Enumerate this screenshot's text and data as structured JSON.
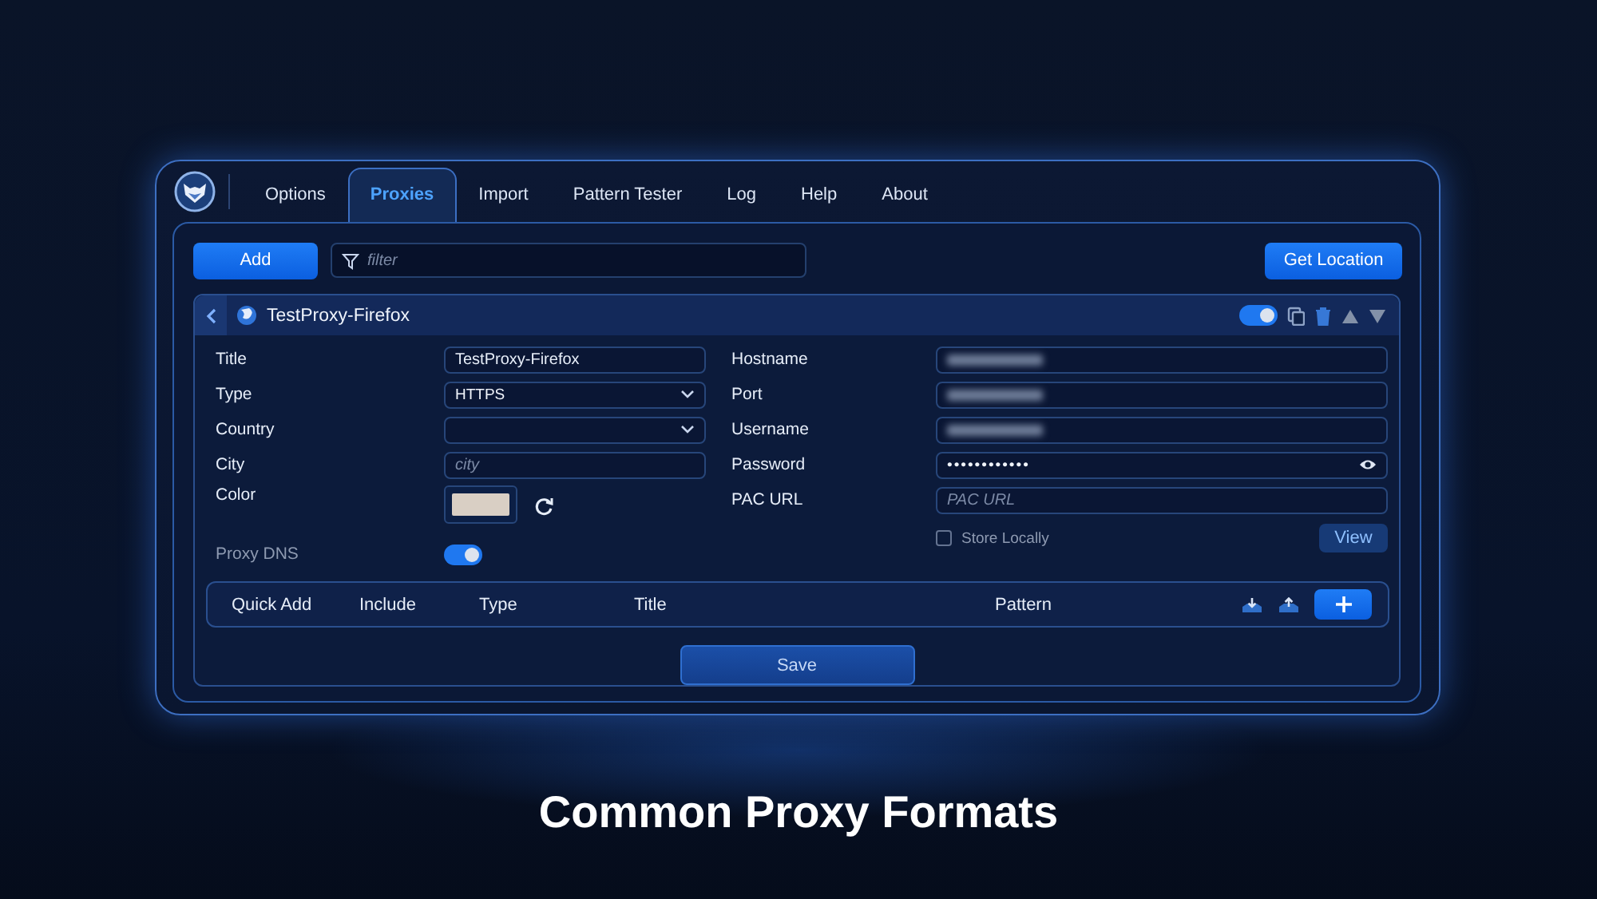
{
  "tabs": [
    {
      "label": "Options",
      "selected": false
    },
    {
      "label": "Proxies",
      "selected": true
    },
    {
      "label": "Import",
      "selected": false
    },
    {
      "label": "Pattern Tester",
      "selected": false
    },
    {
      "label": "Log",
      "selected": false
    },
    {
      "label": "Help",
      "selected": false
    },
    {
      "label": "About",
      "selected": false
    }
  ],
  "toolbar": {
    "add_button": "Add",
    "filter": {
      "placeholder": "filter"
    },
    "location_button": "Get Location"
  },
  "proxy": {
    "title": "TestProxy-Firefox",
    "enabled": true,
    "left_fields": [
      {
        "label": "Title",
        "kind": "text",
        "value": "TestProxy-Firefox"
      },
      {
        "label": "Type",
        "kind": "select",
        "value": "HTTPS"
      },
      {
        "label": "Country",
        "kind": "select"
      },
      {
        "label": "City",
        "kind": "text",
        "placeholder": "city"
      },
      {
        "label": "Color",
        "kind": "color",
        "color": "#d9cfc4"
      }
    ],
    "proxy_dns": {
      "label": "Proxy DNS",
      "on": true
    },
    "right_fields": [
      {
        "label": "Hostname",
        "kind": "blurred"
      },
      {
        "label": "Port",
        "kind": "blurred"
      },
      {
        "label": "Username",
        "kind": "blurred"
      },
      {
        "label": "Password",
        "kind": "password",
        "value": "••••••••••••"
      },
      {
        "label": "PAC URL",
        "kind": "text",
        "placeholder": "PAC URL"
      }
    ],
    "store_locally": {
      "label": "Store Locally",
      "checked": false
    },
    "view_button": "View"
  },
  "patterns": {
    "columns": [
      "Quick Add",
      "Include",
      "Type",
      "Title",
      "Pattern"
    ]
  },
  "save_button": "Save",
  "caption": "Common Proxy Formats"
}
